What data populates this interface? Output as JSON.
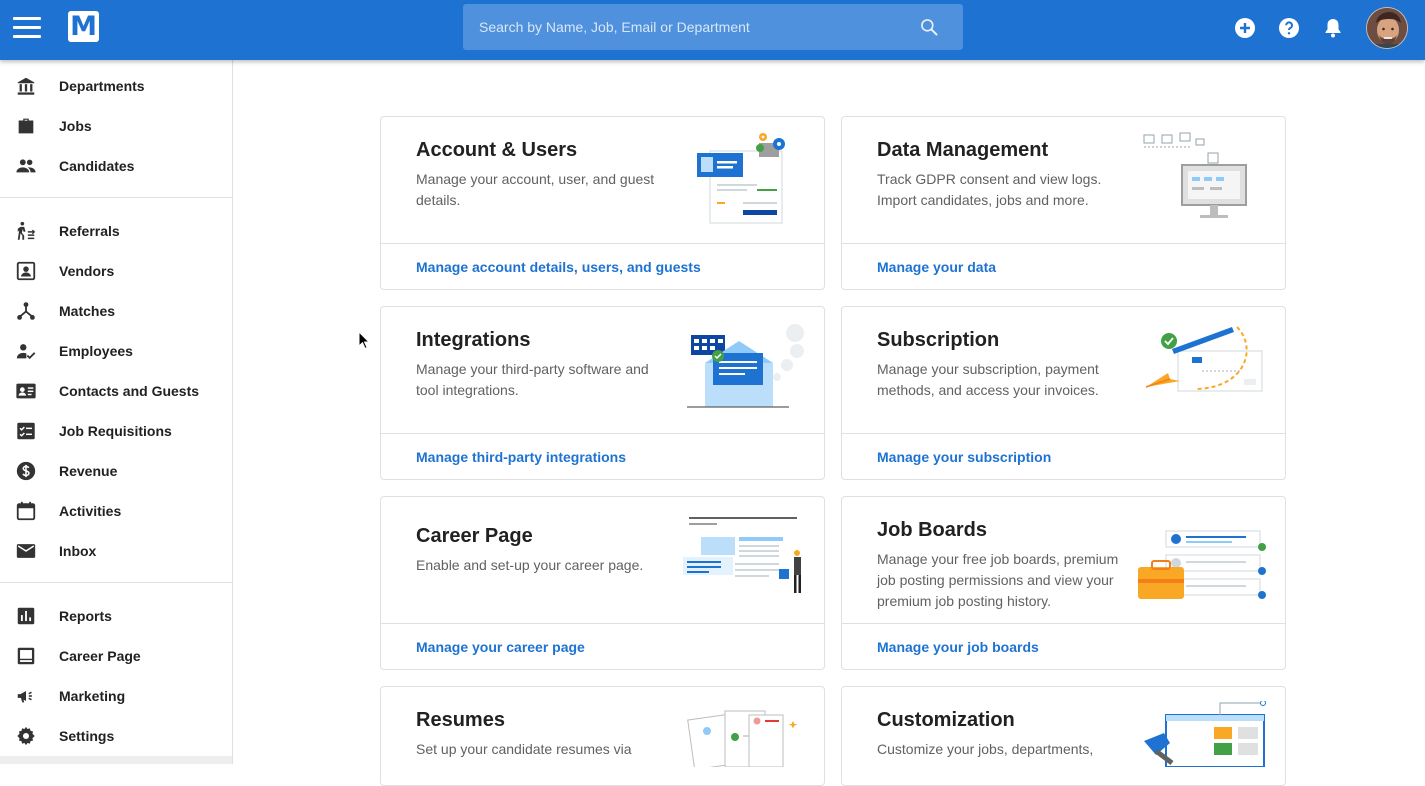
{
  "header": {
    "logo_letter": "M",
    "search_placeholder": "Search by Name, Job, Email or Department"
  },
  "sidebar": {
    "groups": [
      [
        {
          "label": "Departments",
          "icon": "departments-icon"
        },
        {
          "label": "Jobs",
          "icon": "briefcase-icon"
        },
        {
          "label": "Candidates",
          "icon": "people-icon"
        }
      ],
      [
        {
          "label": "Referrals",
          "icon": "referral-icon"
        },
        {
          "label": "Vendors",
          "icon": "vendor-icon"
        },
        {
          "label": "Matches",
          "icon": "matches-icon"
        },
        {
          "label": "Employees",
          "icon": "employee-icon"
        },
        {
          "label": "Contacts and Guests",
          "icon": "contact-card-icon"
        },
        {
          "label": "Job Requisitions",
          "icon": "checklist-icon"
        },
        {
          "label": "Revenue",
          "icon": "dollar-icon"
        },
        {
          "label": "Activities",
          "icon": "calendar-icon"
        },
        {
          "label": "Inbox",
          "icon": "mail-icon"
        }
      ],
      [
        {
          "label": "Reports",
          "icon": "bar-chart-icon"
        },
        {
          "label": "Career Page",
          "icon": "web-page-icon"
        },
        {
          "label": "Marketing",
          "icon": "megaphone-icon"
        },
        {
          "label": "Settings",
          "icon": "gear-icon"
        }
      ]
    ]
  },
  "cards": [
    {
      "title": "Account & Users",
      "desc": "Manage your account, user, and guest details.",
      "link": "Manage account details, users, and guests",
      "illustration": "account-users-illustration"
    },
    {
      "title": "Data Management",
      "desc": "Track GDPR consent and view logs. Import candidates, jobs and more.",
      "link": "Manage your data",
      "illustration": "data-management-illustration"
    },
    {
      "title": "Integrations",
      "desc": "Manage your third-party software and tool integrations.",
      "link": "Manage third-party integrations",
      "illustration": "integrations-illustration"
    },
    {
      "title": "Subscription",
      "desc": "Manage your subscription, payment methods, and access your invoices.",
      "link": "Manage your subscription",
      "illustration": "subscription-illustration"
    },
    {
      "title": "Career Page",
      "desc": "Enable and set-up your career page.",
      "link": "Manage your career page",
      "illustration": "career-page-illustration"
    },
    {
      "title": "Job Boards",
      "desc": "Manage your free job boards, premium job posting permissions and view your premium job posting history.",
      "link": "Manage your job boards",
      "illustration": "job-boards-illustration"
    },
    {
      "title": "Resumes",
      "desc": "Set up your candidate resumes via",
      "link": "",
      "illustration": "resumes-illustration"
    },
    {
      "title": "Customization",
      "desc": "Customize your jobs, departments,",
      "link": "",
      "illustration": "customization-illustration"
    }
  ],
  "colors": {
    "primary": "#1e73d2",
    "accent_green": "#43a047",
    "accent_orange": "#f9a825"
  }
}
